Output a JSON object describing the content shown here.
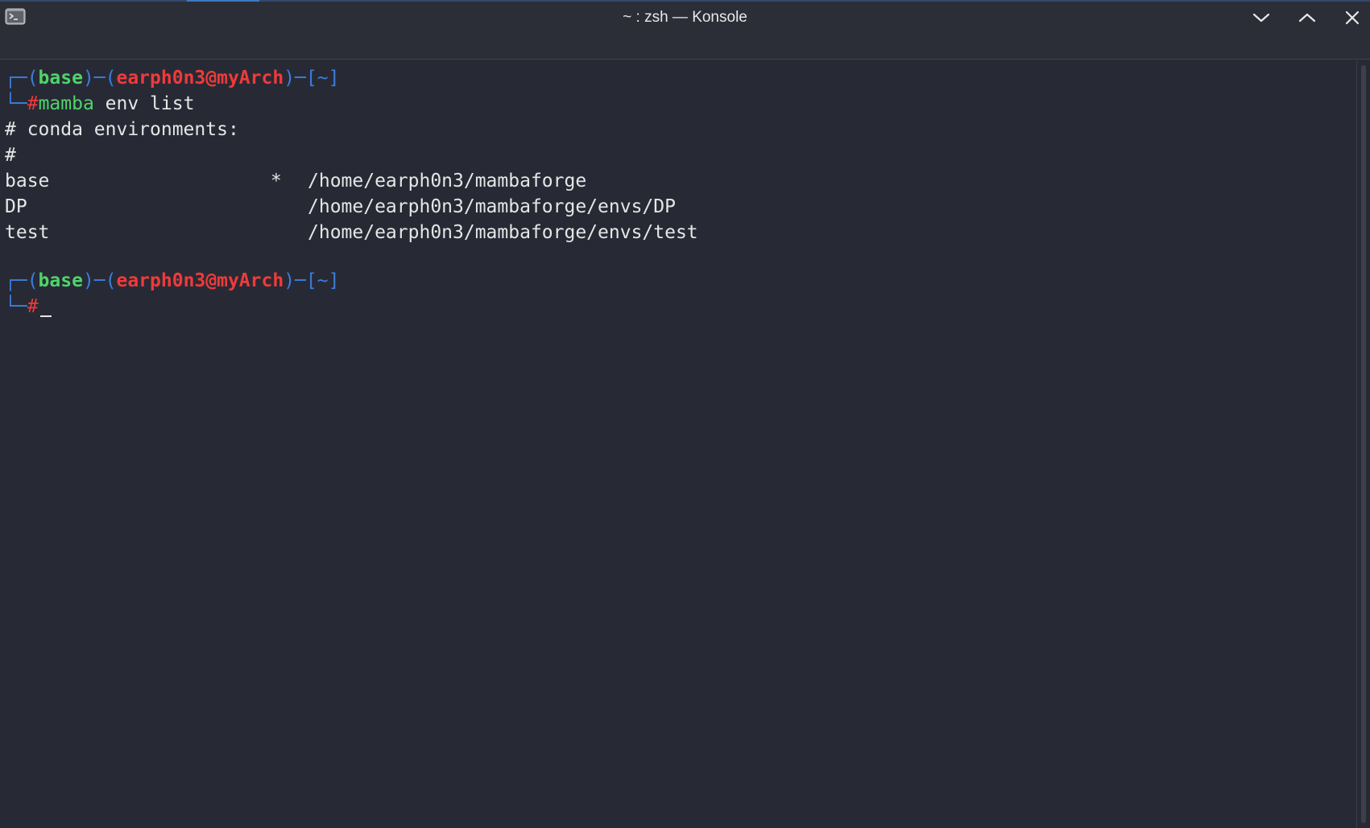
{
  "window": {
    "title": "~ : zsh — Konsole",
    "icon": "terminal-icon",
    "controls": [
      "minimize-icon",
      "maximize-icon",
      "close-icon"
    ]
  },
  "prompt": {
    "open": "┌─(",
    "env": "base",
    "sep1": ")─(",
    "user_host": "earph0n3@myArch",
    "sep2": ")─[",
    "cwd": "~",
    "close": "]",
    "second_line_prefix": "└─",
    "symbol": "#"
  },
  "session": {
    "command_program": "mamba",
    "command_args": " env list",
    "output_header": "# conda environments:",
    "output_hash": "#",
    "environments": [
      {
        "name": "base",
        "marker": "*",
        "path": "/home/earph0n3/mambaforge"
      },
      {
        "name": "DP",
        "marker": "",
        "path": "/home/earph0n3/mambaforge/envs/DP"
      },
      {
        "name": "test",
        "marker": "",
        "path": "/home/earph0n3/mambaforge/envs/test"
      }
    ]
  },
  "colors": {
    "background": "#272a35",
    "prompt_blue": "#3b7ddd",
    "prompt_green": "#4fd46a",
    "prompt_red": "#f03a3a",
    "text": "#e6e6e6"
  }
}
